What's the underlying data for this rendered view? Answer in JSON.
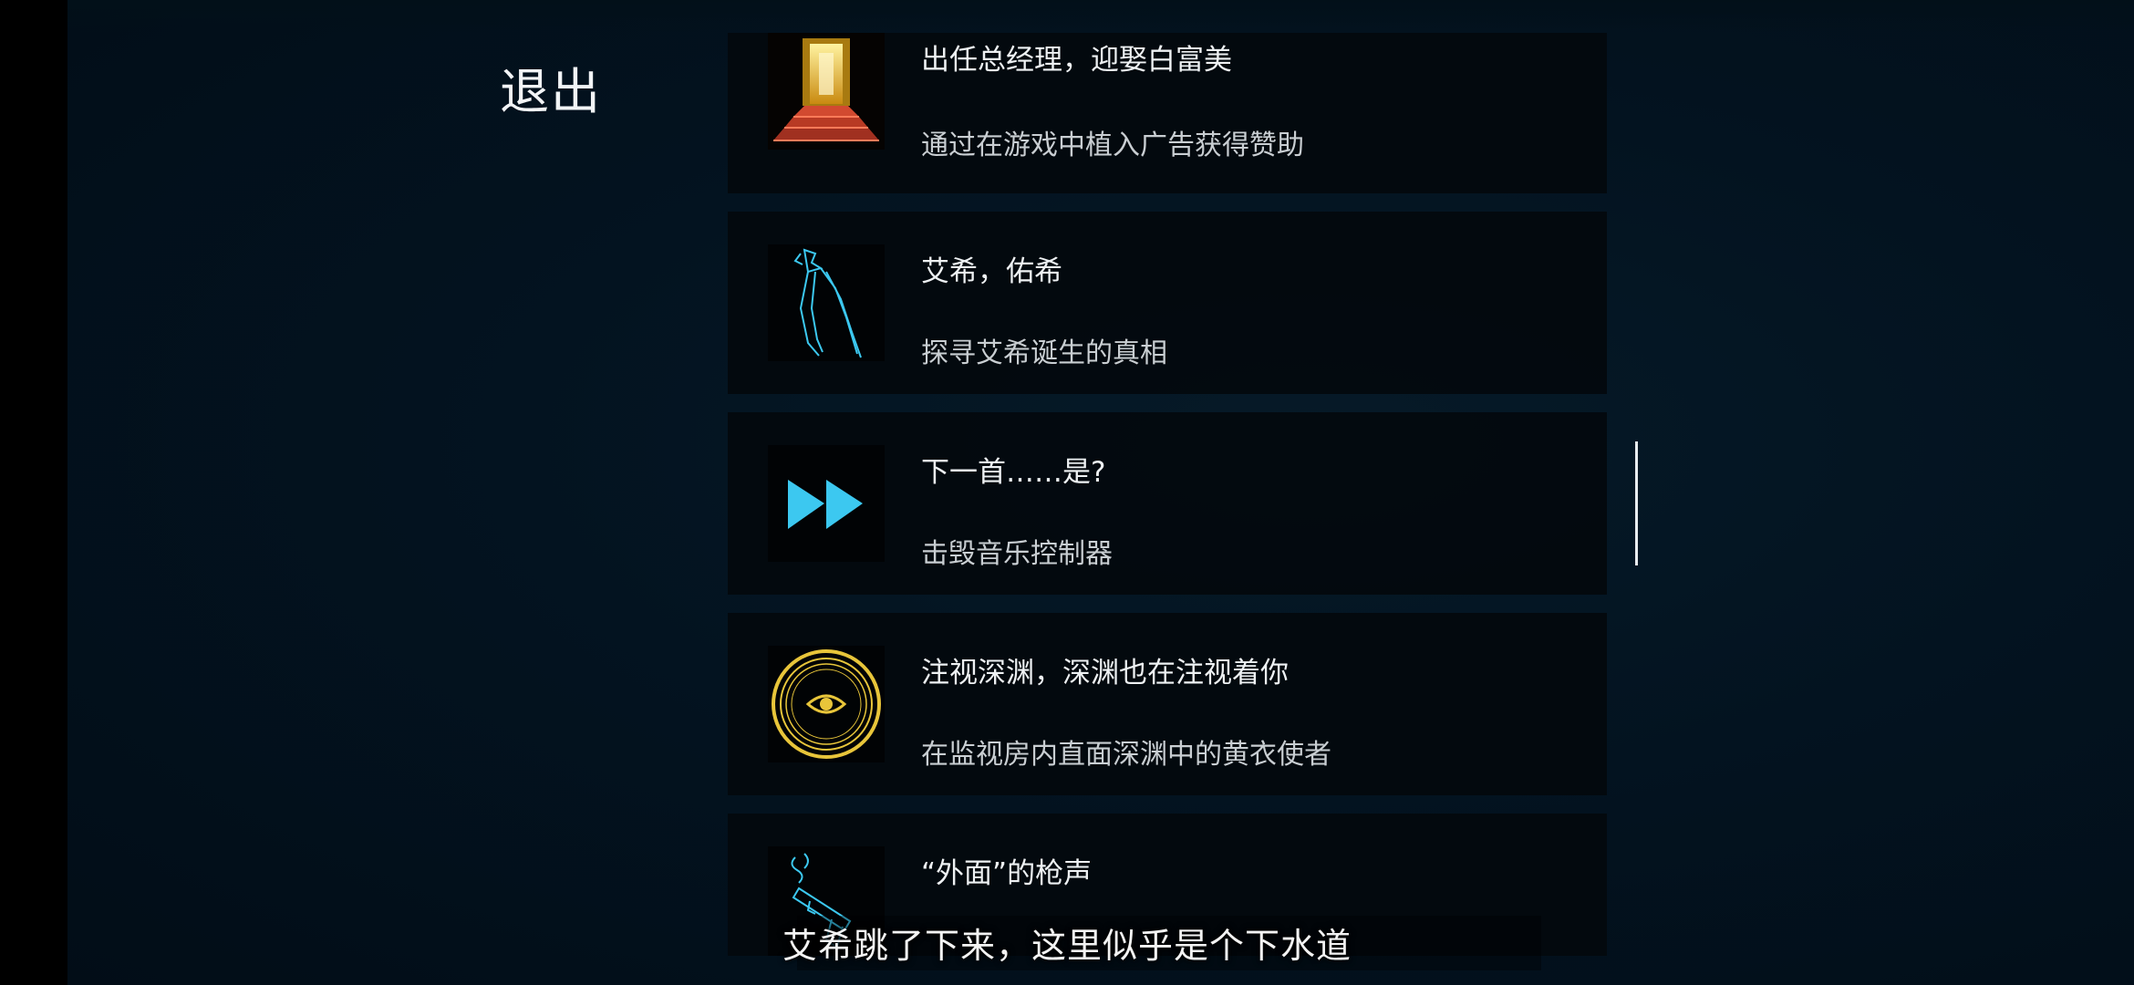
{
  "menu": {
    "exit_label": "退出"
  },
  "achievements": [
    {
      "title": "出任总经理，迎娶白富美",
      "desc": "通过在游戏中植入广告获得赞助",
      "icon": "golden-door-red-carpet-icon"
    },
    {
      "title": "艾希，佑希",
      "desc": "探寻艾希诞生的真相",
      "icon": "blade-sketch-icon"
    },
    {
      "title": "下一首……是?",
      "desc": "击毁音乐控制器",
      "icon": "fast-forward-icon"
    },
    {
      "title": "注视深渊，深渊也在注视着你",
      "desc": "在监视房内直面深渊中的黄衣使者",
      "icon": "eye-medallion-icon"
    },
    {
      "title": "“外面”的枪声",
      "desc": "",
      "icon": "smoking-gun-icon"
    }
  ],
  "subtitle": {
    "text": "艾希跳了下来，这里似乎是个下水道"
  },
  "colors": {
    "background": "#031320",
    "card": "#03090d",
    "accent_cyan": "#3cc8f0",
    "accent_gold": "#e8c53a",
    "carpet_red": "#c0402a"
  }
}
